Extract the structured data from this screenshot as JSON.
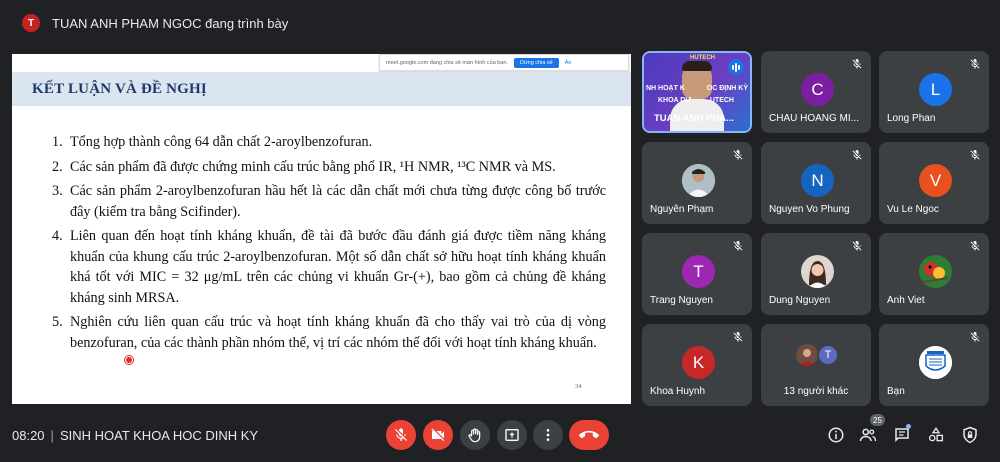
{
  "presenter_banner": {
    "initial": "T",
    "text": "TUAN ANH PHAM NGOC đang trình bày"
  },
  "share_banner": {
    "text": "meet.google.com đang chia sẻ màn hình của bạn.",
    "stop": "Dừng chia sẻ",
    "hide": "Ẩn"
  },
  "slide": {
    "title": "KẾT LUẬN VÀ ĐỀ NGHỊ",
    "items": [
      {
        "num": "1.",
        "text": "Tổng hợp thành công 64 dẫn chất 2-aroylbenzofuran."
      },
      {
        "num": "2.",
        "text": "Các sản phẩm đã được chứng minh cấu trúc bằng phổ IR, ¹H NMR, ¹³C NMR và MS."
      },
      {
        "num": "3.",
        "text": "Các sản phẩm 2-aroylbenzofuran hầu hết là các dẫn chất mới chưa từng được công bố trước đây (kiểm tra bằng Scifinder)."
      },
      {
        "num": "4.",
        "text": "Liên quan đến hoạt tính kháng khuẩn, đề tài đã bước đầu đánh giá được tiềm năng kháng khuẩn của khung cấu trúc 2-aroylbenzofuran. Một số dẫn chất sở hữu hoạt tính kháng khuẩn khá tốt với MIC = 32 μg/mL trên các chủng vi khuẩn Gr-(+), bao gồm cả chủng đề kháng kháng sinh MRSA."
      },
      {
        "num": "5.",
        "text": "Nghiên cứu liên quan cấu trúc và hoạt tính kháng khuẩn đã cho thấy vai trò của dị vòng benzofuran, của các thành phần nhóm thế, vị trí các nhóm thế đối với hoạt tính kháng khuẩn."
      }
    ],
    "page_number": "34"
  },
  "presenter_tile": {
    "line1": "NH HOẠT K",
    "line1b": "OC ĐỊNH KỲ",
    "line2": "KHOA DƯ",
    "line2b": "UTECH",
    "name": "TUAN ANH PHA...",
    "logo": "HUTECH"
  },
  "participants": [
    {
      "name": "CHAU HOANG MI...",
      "initial": "C",
      "color": "#7b1fa2",
      "kind": "letter"
    },
    {
      "name": "Long Phan",
      "initial": "L",
      "color": "#1a73e8",
      "kind": "letter"
    },
    {
      "name": "Nguyên Phạm",
      "initial": "",
      "color": "#bdbdbd",
      "kind": "photo-man"
    },
    {
      "name": "Nguyen Vo Phung",
      "initial": "N",
      "color": "#1565c0",
      "kind": "letter"
    },
    {
      "name": "Vu Le Ngoc",
      "initial": "V",
      "color": "#e8501e",
      "kind": "letter"
    },
    {
      "name": "Trang Nguyen",
      "initial": "T",
      "color": "#9c27b0",
      "kind": "letter"
    },
    {
      "name": "Dung Nguyen",
      "initial": "",
      "color": "#d7ccc8",
      "kind": "photo-woman"
    },
    {
      "name": "Anh Viet",
      "initial": "",
      "color": "#2e7d32",
      "kind": "photo-bird"
    },
    {
      "name": "Khoa Huynh",
      "initial": "K",
      "color": "#c62828",
      "kind": "letter"
    },
    {
      "name": "13 người khác",
      "initial": "T",
      "color": "#5c6bc0",
      "kind": "group"
    },
    {
      "name": "Bạn",
      "initial": "",
      "color": "#ffffff",
      "kind": "photo-logo"
    }
  ],
  "bottom": {
    "time": "08:20",
    "meeting_title": "SINH HOAT KHOA HOC DINH KY",
    "participant_count": "25"
  },
  "colors": {
    "end_call": "#ea4335",
    "muted": "#ea4335",
    "tile": "#3c4043",
    "background": "#202124"
  }
}
